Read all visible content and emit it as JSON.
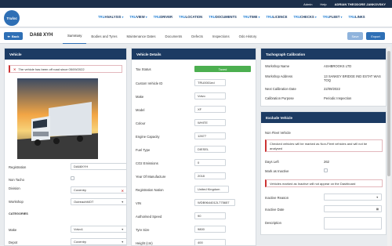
{
  "topbar": {
    "admin": "Admin",
    "help": "Help",
    "user": "ADRIAN THEODORE JANKOVSKY"
  },
  "logo": "Truloc",
  "nav": [
    {
      "pre": "TRU",
      "rest": "ANALYSIS"
    },
    {
      "pre": "TRU",
      "rest": "VIEW"
    },
    {
      "pre": "TRU",
      "rest": "DRIVER"
    },
    {
      "pre": "TRU",
      "rest": "LOCATION"
    },
    {
      "pre": "TRU",
      "rest": "DOCUMENTS"
    },
    {
      "pre": "TRU",
      "rest": "TIME"
    },
    {
      "pre": "TRU",
      "rest": "LICENCE"
    },
    {
      "pre": "TRU",
      "rest": "CHECKS"
    },
    {
      "pre": "TRU",
      "rest": "FLEET"
    },
    {
      "pre": "TRU",
      "rest": "LINKS"
    }
  ],
  "toolbar": {
    "back_label": "Back",
    "registration": "DA68 XYH",
    "tabs": [
      "Summary",
      "Bodies and Tyres",
      "Maintenance Dates",
      "Documents",
      "Defects",
      "Inspections",
      "Odo History"
    ],
    "save_label": "Save",
    "export_label": "Export"
  },
  "vehicle": {
    "header": "Vehicle",
    "alert": "The vehicle has been off road since 05/09/2022",
    "registration_label": "Registration",
    "registration_value": "DA68XYH",
    "nontacho_label": "Non Tacho",
    "division_label": "Division",
    "division_value": "Coventry",
    "workshop_label": "Workshop",
    "workshop_value": "OutreachMOT",
    "categories_label": "CATEGORIES",
    "make_label": "Make",
    "make_value": "Volvo1",
    "depot_label": "Depot",
    "depot_value": "Coventry"
  },
  "details": {
    "header": "Vehicle Details",
    "rows": [
      {
        "label": "Tax Status",
        "value": "Taxed"
      },
      {
        "label": "Custom Vehicle ID",
        "value": "TRU0001ed"
      },
      {
        "label": "Make",
        "value": "Volvo"
      },
      {
        "label": "Model",
        "value": "XF"
      },
      {
        "label": "Colour",
        "value": "WHITE"
      },
      {
        "label": "Engine Capacity",
        "value": "12677"
      },
      {
        "label": "Fuel Type",
        "value": "DIESEL"
      },
      {
        "label": "CO2 Emissions",
        "value": "0"
      },
      {
        "label": "Year Of Manufacture",
        "value": "2018"
      },
      {
        "label": "Registration Nation",
        "value": "United Kingdom"
      },
      {
        "label": "VIN",
        "value": "WDB9644012L775657"
      },
      {
        "label": "Authorised Speed",
        "value": "90"
      },
      {
        "label": "Tyre Size",
        "value": "9800"
      },
      {
        "label": "Height (cm)",
        "value": "400"
      }
    ]
  },
  "tacho": {
    "header": "Tachograph Calibration",
    "rows": [
      {
        "label": "Workshop Name",
        "value": "ASHBROOKS LTD"
      },
      {
        "label": "Workshop Address",
        "value": "13 SANKEY BRIDGE IND ESTAT WAS TOQ"
      },
      {
        "label": "Next Calibration Date",
        "value": "22/09/2022"
      },
      {
        "label": "Calibration Purpose",
        "value": "Periodic Inspection"
      }
    ]
  },
  "exclude": {
    "header": "Exclude Vehicle",
    "nonfleet_label": "Non Fleet Vehicle",
    "nonfleet_alert": "Checked vehicles will be marked as Non-Fleet vehicles and will not be analysed",
    "daysleft_label": "Days Left",
    "daysleft_value": "262",
    "inactive_label": "Mark as Inactive",
    "inactive_alert": "Vehicles marked as Inactive will not appear on the Dashboard",
    "reason_label": "Inactive Reason",
    "date_label": "Inactive Date",
    "desc_label": "Description"
  },
  "colors": {
    "navy": "#1c3b63",
    "accent": "#2e6fb5",
    "taxed": "#4caf50"
  }
}
